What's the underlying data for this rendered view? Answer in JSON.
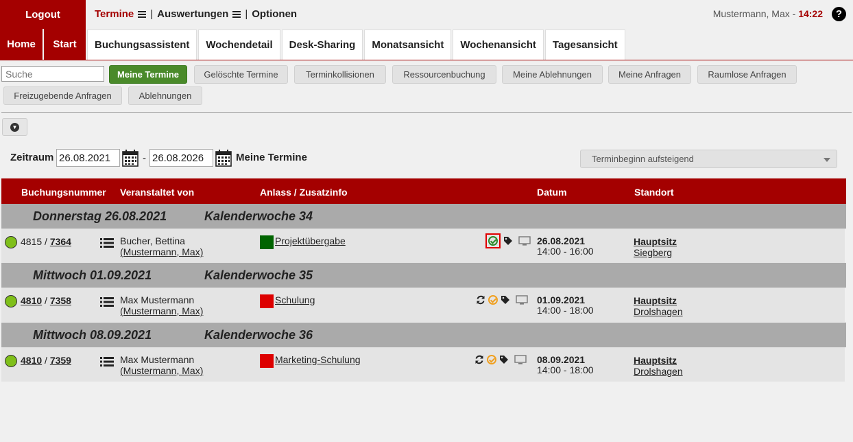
{
  "topbar": {
    "logout": "Logout",
    "menu": [
      {
        "label": "Termine"
      },
      {
        "label": "Auswertungen"
      },
      {
        "label": "Optionen"
      }
    ],
    "separator": "|",
    "user": "Mustermann, Max - ",
    "time": "14:22",
    "help": "?"
  },
  "tabs": {
    "home": "Home",
    "start": "Start",
    "items": [
      "Buchungsassistent",
      "Wochendetail",
      "Desk-Sharing",
      "Monatsansicht",
      "Wochenansicht",
      "Tagesansicht"
    ]
  },
  "search": {
    "placeholder": "Suche"
  },
  "filters": [
    "Meine Termine",
    "Gelöschte Termine",
    "Terminkollisionen",
    "Ressourcenbuchung",
    "Meine Ablehnungen",
    "Meine Anfragen",
    "Raumlose Anfragen",
    "Freizugebende Anfragen",
    "Ablehnungen"
  ],
  "range": {
    "label": "Zeitraum",
    "from": "26.08.2021",
    "dash": "-",
    "to": "26.08.2026",
    "scope": "Meine Termine",
    "sort": "Terminbeginn aufsteigend"
  },
  "table": {
    "headers": [
      "Buchungsnummer",
      "Veranstaltet von",
      "Anlass / Zusatzinfo",
      "Datum",
      "Standort"
    ],
    "groups": [
      {
        "day": "Donnerstag 26.08.2021",
        "week": "Kalenderwoche 34"
      },
      {
        "day": "Mittwoch 01.09.2021",
        "week": "Kalenderwoche 35"
      },
      {
        "day": "Mittwoch 08.09.2021",
        "week": "Kalenderwoche 36"
      }
    ],
    "rows": [
      {
        "n1": "4815",
        "slash": " / ",
        "n2": "7364",
        "organizer": "Bucher, Bettina",
        "on_behalf": "(Mustermann, Max)",
        "occasion": "Projektübergabe",
        "color": "#006400",
        "date": "26.08.2021",
        "time": "14:00 - 16:00",
        "location": "Hauptsitz",
        "city": "Siegberg"
      },
      {
        "n1": "4810",
        "slash": " / ",
        "n2": "7358",
        "organizer": "Max Mustermann",
        "on_behalf": "(Mustermann, Max)",
        "occasion": "Schulung",
        "color": "#dd0000",
        "date": "01.09.2021",
        "time": "14:00 - 18:00",
        "location": "Hauptsitz",
        "city": "Drolshagen"
      },
      {
        "n1": "4810",
        "slash": " / ",
        "n2": "7359",
        "organizer": "Max Mustermann",
        "on_behalf": "(Mustermann, Max)",
        "occasion": "Marketing-Schulung",
        "color": "#dd0000",
        "date": "08.09.2021",
        "time": "14:00 - 18:00",
        "location": "Hauptsitz",
        "city": "Drolshagen"
      }
    ]
  },
  "colors": {
    "brand": "#a40000",
    "active_filter": "#4a8a2a",
    "status_dot": "#7fbf1a"
  },
  "icons": [
    "help-icon",
    "burger-icon",
    "chevron-down-icon",
    "calendar-icon",
    "list-icon",
    "check-circle-icon",
    "tag-icon",
    "monitor-icon",
    "sync-icon"
  ]
}
